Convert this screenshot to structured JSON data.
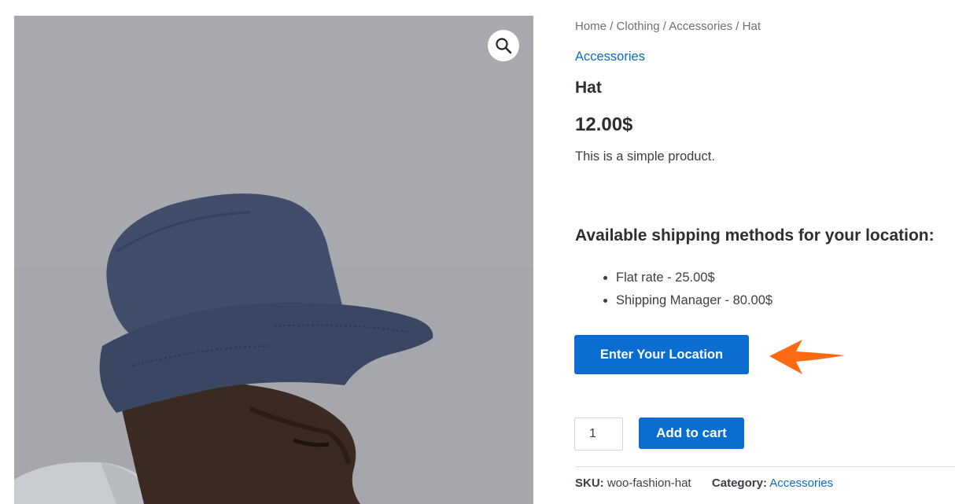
{
  "breadcrumb": {
    "home": "Home",
    "clothing": "Clothing",
    "accessories": "Accessories",
    "current": "Hat",
    "separator": "/"
  },
  "product": {
    "category_link": "Accessories",
    "title": "Hat",
    "price": "12.00$",
    "short_description": "This is a simple product."
  },
  "shipping": {
    "heading": "Available shipping methods for your location:",
    "methods": [
      "Flat rate - 25.00$",
      "Shipping Manager - 80.00$"
    ],
    "location_button": "Enter Your Location"
  },
  "cart": {
    "quantity": "1",
    "add_to_cart": "Add to cart"
  },
  "meta": {
    "sku_label": "SKU:",
    "sku_value": "woo-fashion-hat",
    "category_label": "Category:",
    "category_value": "Accessories"
  },
  "icons": {
    "zoom": "magnifier-icon",
    "annotation": "arrow-left-icon"
  },
  "colors": {
    "accent": "#0a6ed1",
    "link": "#0d6cbf",
    "annotation_arrow": "#ff6a13",
    "image_background": "#a6a6ac"
  }
}
